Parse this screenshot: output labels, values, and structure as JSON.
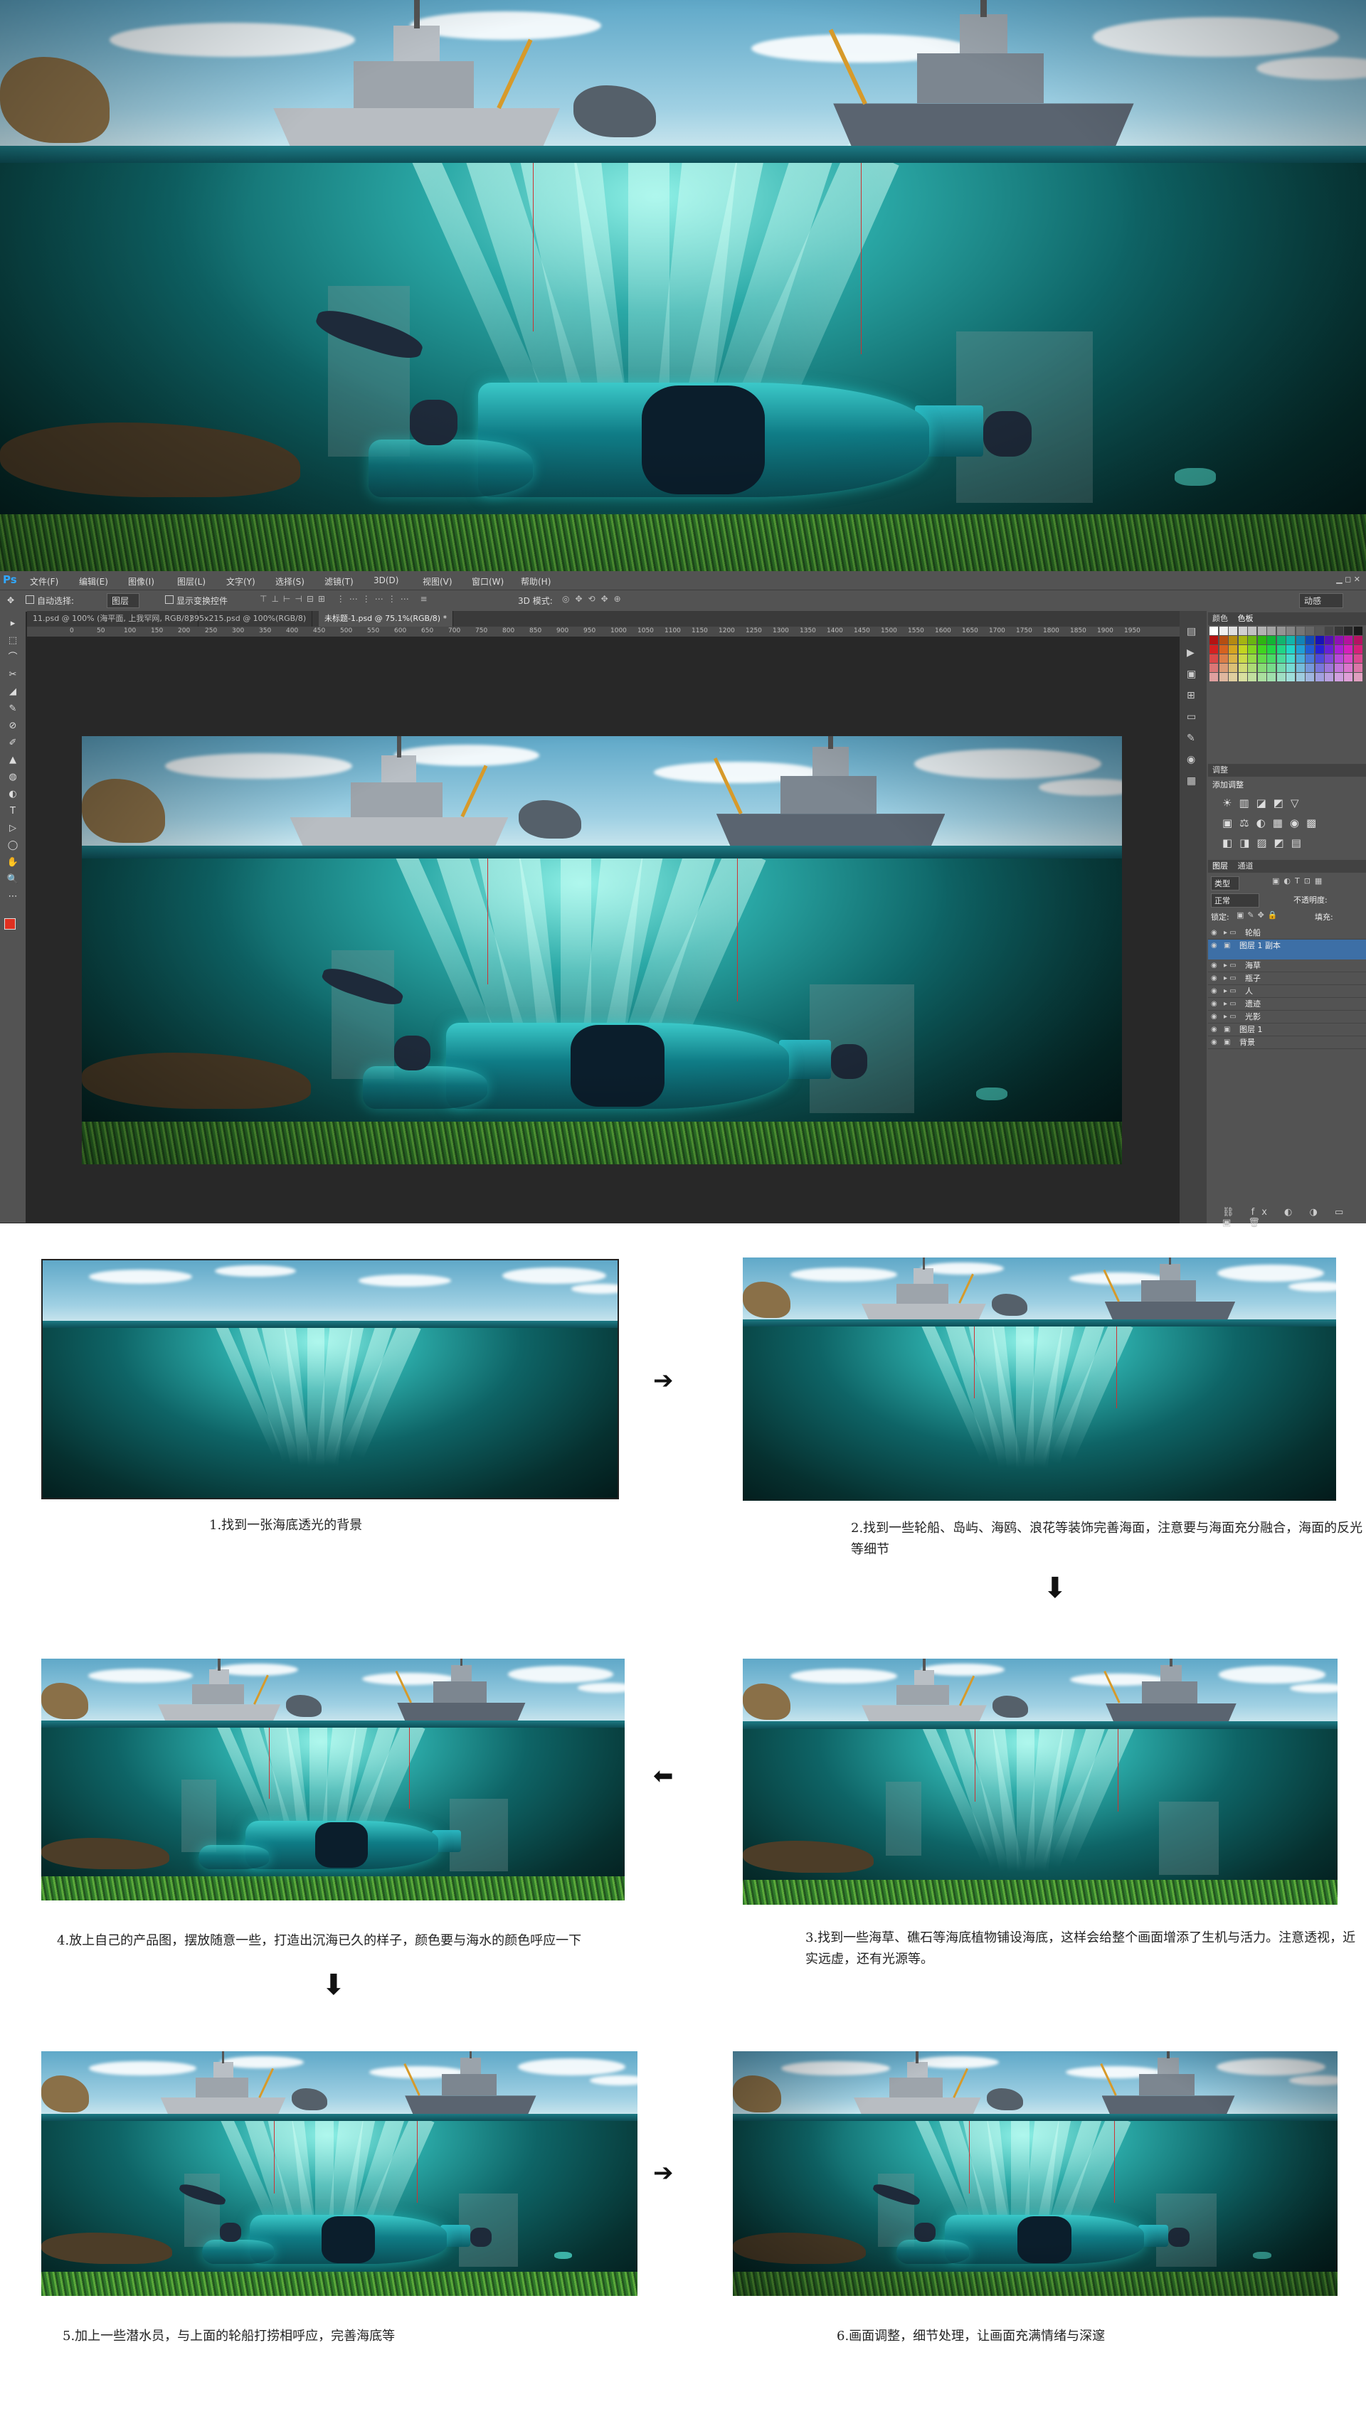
{
  "hero": {
    "alt": ""
  },
  "photoshop": {
    "logo": "Ps",
    "menu": [
      "文件(F)",
      "编辑(E)",
      "图像(I)",
      "图层(L)",
      "文字(Y)",
      "选择(S)",
      "滤镜(T)",
      "3D(D)",
      "视图(V)",
      "窗口(W)",
      "帮助(H)"
    ],
    "options": {
      "auto_select_label": "自动选择:",
      "auto_select_value": "图层",
      "show_transform": "显示变换控件",
      "mode_3d": "3D 模式:",
      "workspace": "动感"
    },
    "tabs": [
      "11.psd @ 100% (海平面, 上我罕网, RGB/8)",
      "395x215.psd @ 100%(RGB/8)",
      "未标题-1.psd @ 75.1%(RGB/8) *"
    ],
    "ruler": [
      "0",
      "50",
      "100",
      "150",
      "200",
      "250",
      "300",
      "350",
      "400",
      "450",
      "500",
      "550",
      "600",
      "650",
      "700",
      "750",
      "800",
      "850",
      "900",
      "950",
      "1000",
      "1050",
      "1100",
      "1150",
      "1200",
      "1250",
      "1300",
      "1350",
      "1400",
      "1450",
      "1500",
      "1550",
      "1600",
      "1650",
      "1700",
      "1750",
      "1800",
      "1850",
      "1900",
      "1950"
    ],
    "panels": {
      "color_tabs": [
        "颜色",
        "色板"
      ],
      "adjust_title": "调整",
      "adjust_add": "添加调整",
      "layers_tabs": [
        "图层",
        "通道"
      ],
      "kind": "类型",
      "blend": "正常",
      "opacity": "不透明度:",
      "lock": "锁定:",
      "fill": "填充:",
      "layers": [
        {
          "name": "轮船",
          "type": "folder",
          "selected": false
        },
        {
          "name": "图层 1 副本",
          "type": "layer",
          "selected": true
        },
        {
          "name": "海草",
          "type": "folder",
          "selected": false
        },
        {
          "name": "瓶子",
          "type": "folder",
          "selected": false
        },
        {
          "name": "人",
          "type": "folder",
          "selected": false
        },
        {
          "name": "遗迹",
          "type": "folder",
          "selected": false
        },
        {
          "name": "光影",
          "type": "folder",
          "selected": false
        },
        {
          "name": "图层 1",
          "type": "layer",
          "selected": false
        },
        {
          "name": "背景",
          "type": "layer",
          "selected": false
        }
      ]
    }
  },
  "steps": [
    {
      "caption": "1.找到一张海底透光的背景"
    },
    {
      "caption": "2.找到一些轮船、岛屿、海鸥、浪花等装饰完善海面，注意要与海面充分融合，海面的反光等细节"
    },
    {
      "caption": "3.找到一些海草、礁石等海底植物铺设海底，这样会给整个画面增添了生机与活力。注意透视，近实远虚，还有光源等。"
    },
    {
      "caption": "4.放上自己的产品图，摆放随意一些，打造出沉海已久的样子，颜色要与海水的颜色呼应一下"
    },
    {
      "caption": "5.加上一些潜水员，与上面的轮船打捞相呼应，完善海底等"
    },
    {
      "caption": "6.画面调整，细节处理，让画面充满情绪与深邃"
    }
  ],
  "colors": {
    "ps_dark": "#282828",
    "ps_panel": "#535353",
    "ps_blue": "#31a8ff",
    "sea": "#0e6466"
  }
}
